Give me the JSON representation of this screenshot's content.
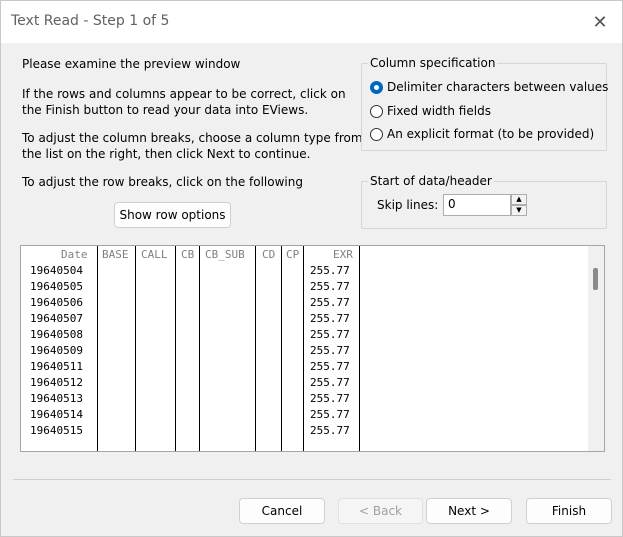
{
  "window": {
    "title": "Text Read - Step 1 of 5",
    "close_glyph": "✕"
  },
  "instructions": {
    "line1": "Please examine the preview window",
    "line2a": "If the rows and columns appear to be correct, click on",
    "line2b": "the Finish button to read your data into EViews.",
    "line3a": "To adjust the column breaks, choose a column type from",
    "line3b": "the list on the right, then click Next to continue.",
    "line4": "To adjust the row breaks, click on the following",
    "show_row_options": "Show row options"
  },
  "column_spec": {
    "title": "Column specification",
    "options": [
      {
        "label": "Delimiter characters between values",
        "checked": true
      },
      {
        "label": "Fixed width fields",
        "checked": false
      },
      {
        "label": "An explicit format (to be provided)",
        "checked": false
      }
    ]
  },
  "start_header": {
    "title": "Start of data/header",
    "skip_label": "Skip lines:",
    "skip_value": "0",
    "up_glyph": "▲",
    "down_glyph": "▼"
  },
  "preview": {
    "headers": [
      "Date",
      "BASE",
      "CALL",
      "CB",
      "CB_SUB",
      "CD",
      "CP",
      "EXR"
    ],
    "rows": [
      [
        "19640504",
        "255.77"
      ],
      [
        "19640505",
        "255.77"
      ],
      [
        "19640506",
        "255.77"
      ],
      [
        "19640507",
        "255.77"
      ],
      [
        "19640508",
        "255.77"
      ],
      [
        "19640509",
        "255.77"
      ],
      [
        "19640511",
        "255.77"
      ],
      [
        "19640512",
        "255.77"
      ],
      [
        "19640513",
        "255.77"
      ],
      [
        "19640514",
        "255.77"
      ],
      [
        "19640515",
        "255.77"
      ]
    ]
  },
  "buttons": {
    "cancel": "Cancel",
    "back": "< Back",
    "next": "Next >",
    "finish": "Finish"
  }
}
